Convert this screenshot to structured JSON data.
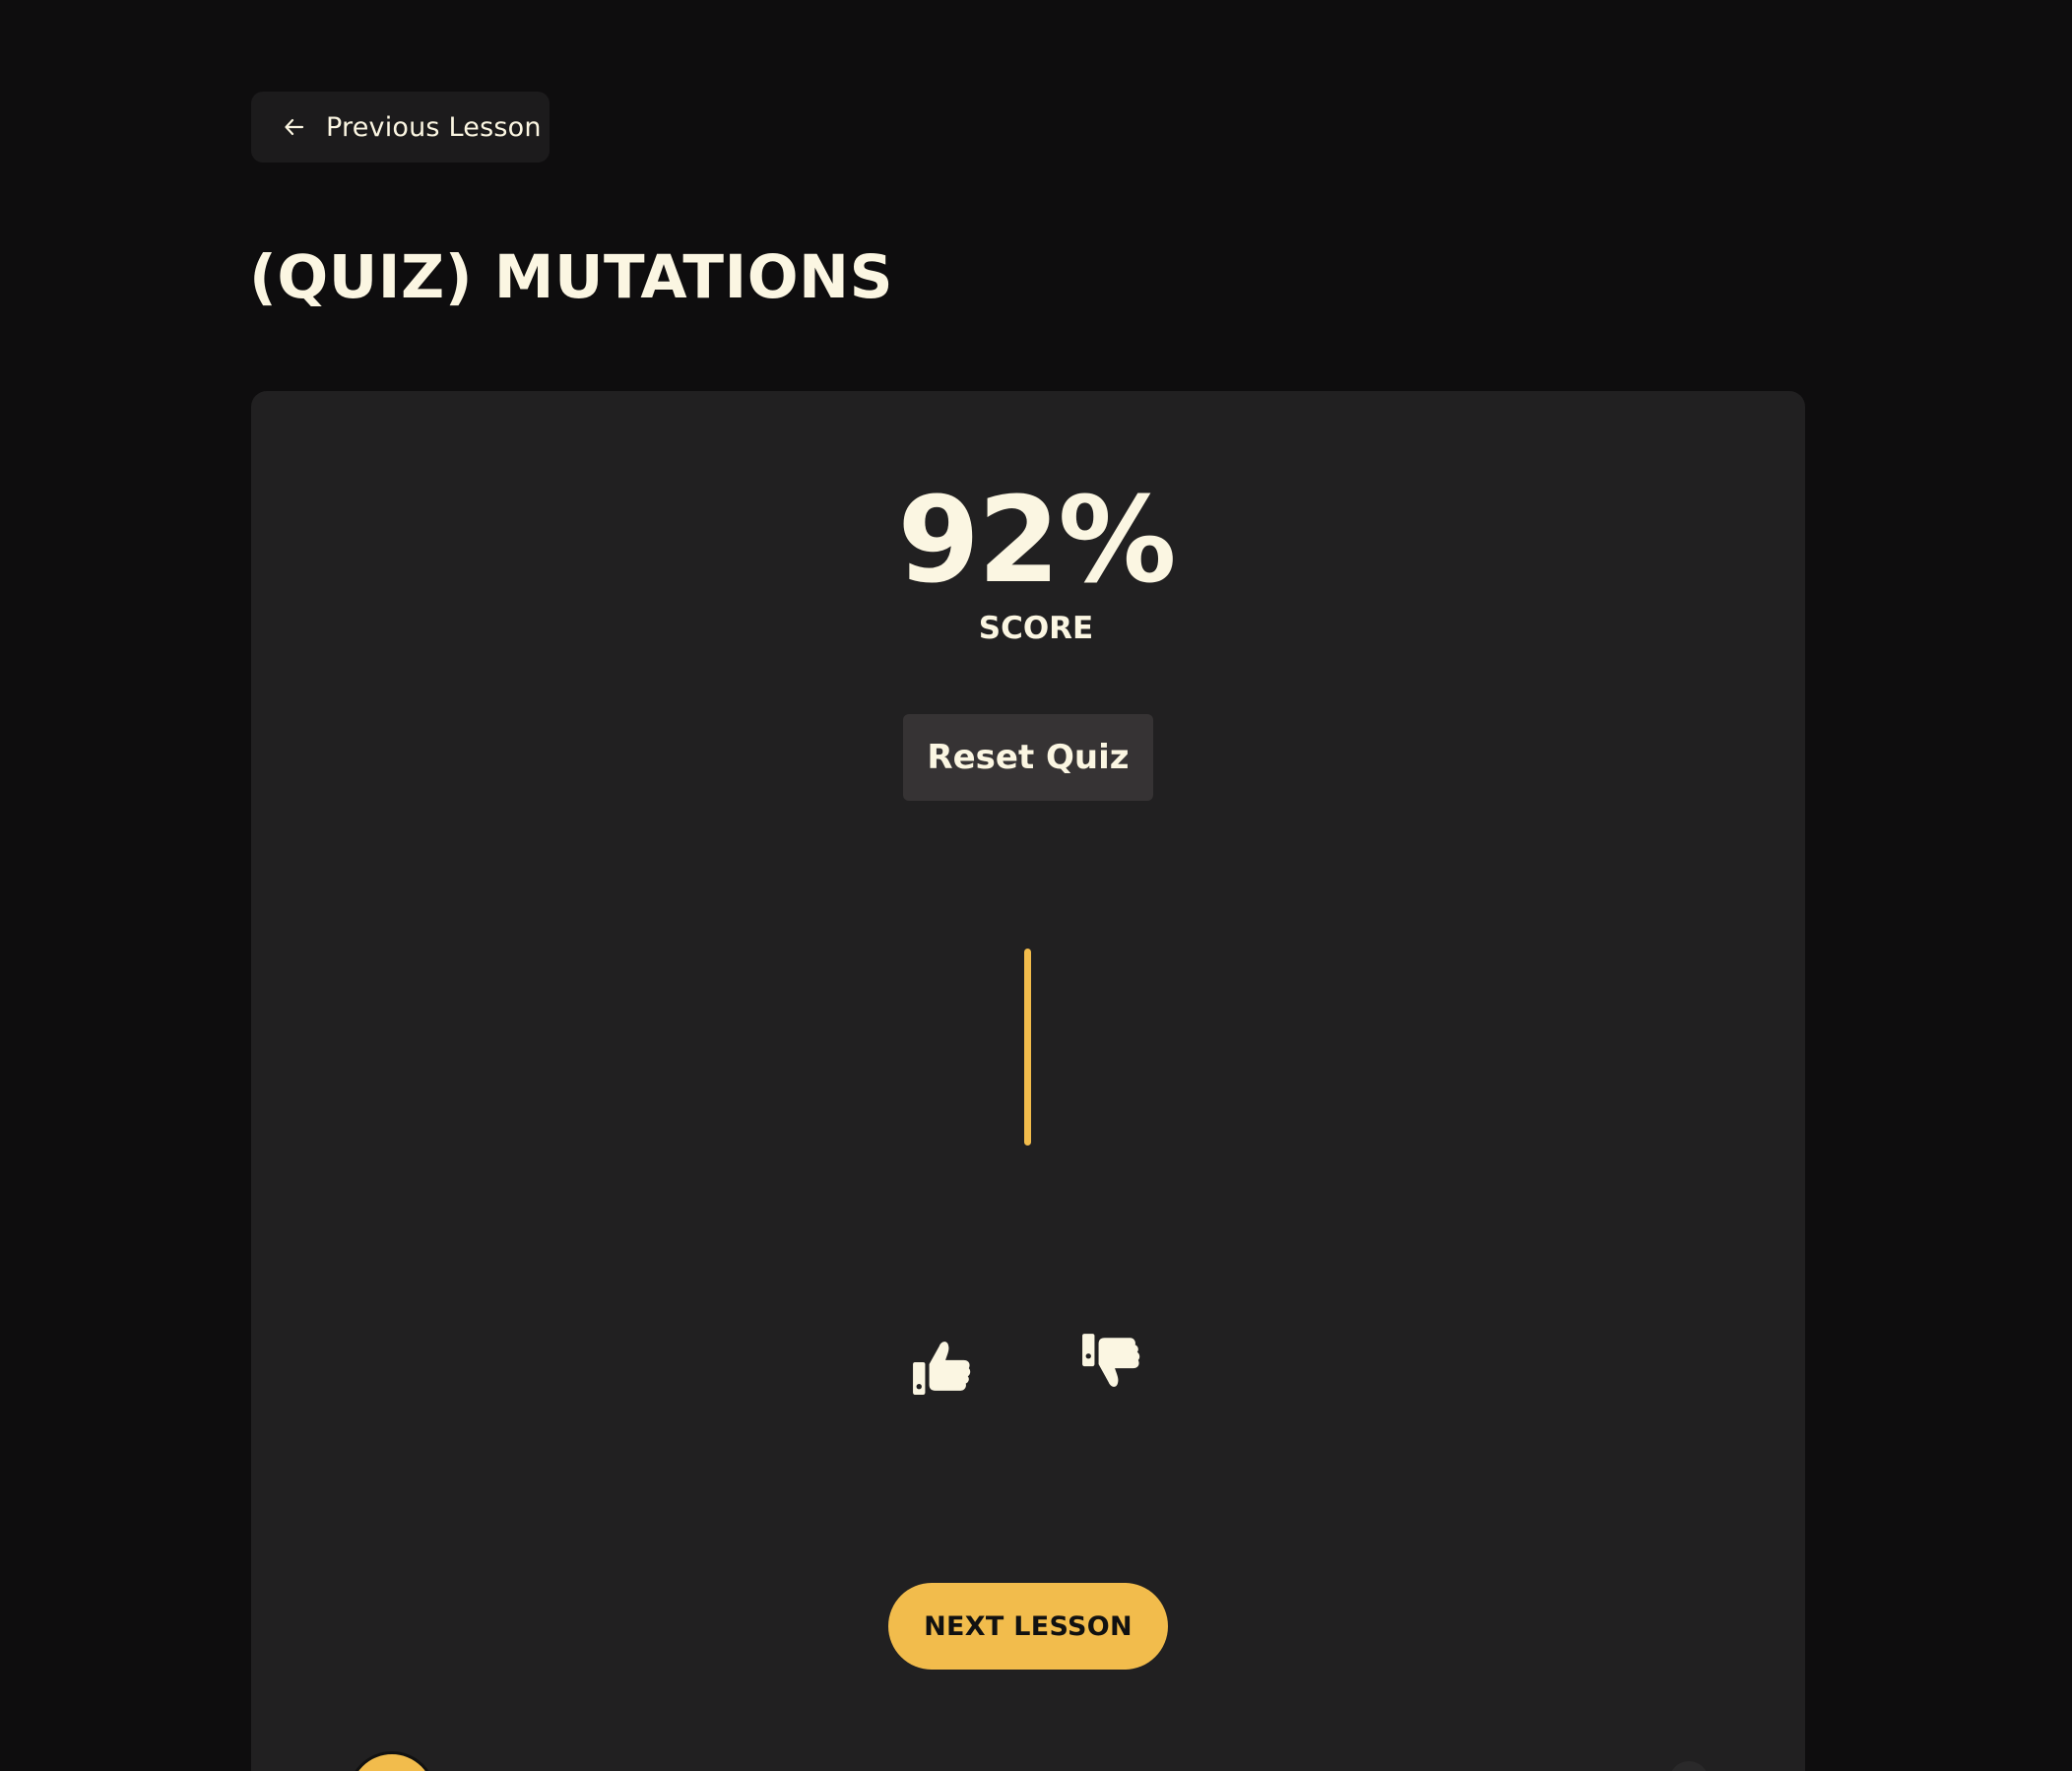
{
  "nav": {
    "previous_label": "Previous Lesson",
    "previous_icon": "arrow-left-icon"
  },
  "page": {
    "title": "(QUIZ) MUTATIONS"
  },
  "result": {
    "score": "92%",
    "score_label": "SCORE",
    "reset_label": "Reset Quiz"
  },
  "feedback": {
    "up_icon": "thumbs-up-icon",
    "down_icon": "thumbs-down-icon"
  },
  "footer": {
    "next_label": "NEXT LESSON"
  },
  "colors": {
    "background": "#0e0d0e",
    "card": "#212021",
    "accent": "#f2bc4c",
    "text": "#fbf6e2",
    "button": "#363334"
  }
}
